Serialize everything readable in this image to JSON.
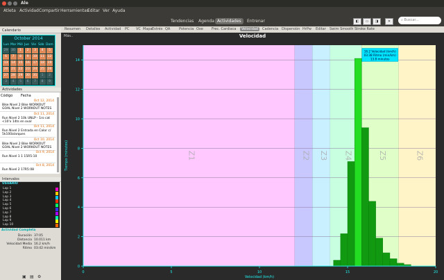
{
  "window": {
    "title": "Ale"
  },
  "menu": [
    "Atleta",
    "Actividad",
    "Compartir",
    "Herramientas",
    "Editar",
    "Ver",
    "Ayuda"
  ],
  "views": [
    {
      "label": "Tendencias",
      "active": false
    },
    {
      "label": "Agenda",
      "active": false
    },
    {
      "label": "Actividades",
      "active": true
    },
    {
      "label": "Entrenar",
      "active": false
    }
  ],
  "search": {
    "placeholder": "Buscar..."
  },
  "calendar": {
    "title": "Calendario",
    "month": "October 2014",
    "dows": [
      "Lun",
      "Mar",
      "Mié",
      "Jue",
      "Vie",
      "Sáb",
      "Dom"
    ],
    "weeks": [
      [
        "29",
        "30",
        "1",
        "2",
        "3",
        "4",
        "5"
      ],
      [
        "6",
        "7",
        "8",
        "9",
        "10",
        "11",
        "12"
      ],
      [
        "13",
        "14",
        "15",
        "16",
        "17",
        "18",
        "19"
      ],
      [
        "20",
        "21",
        "22",
        "23",
        "24",
        "25",
        "26"
      ],
      [
        "27",
        "28",
        "29",
        "30",
        "31",
        "1",
        "2"
      ],
      [
        "3",
        "4",
        "5",
        "6",
        "7",
        "8",
        "9"
      ]
    ]
  },
  "activities": {
    "title": "Actividades",
    "col_code": "Código",
    "col_date": "Fecha",
    "items": [
      {
        "date": "Oct 12, 2014",
        "name": "Bike Nivel 2 Bike  WORKOUT GOAL Nivel 2 WORKOUT NOTES"
      },
      {
        "date": "Oct 11, 2014",
        "name": "Run Nivel 2 10k UNLP - 1ro cat <10'x 14ts en oval"
      },
      {
        "date": "Oct 11, 2014",
        "name": "Run Nivel 2 Entrada en Calor c/ 5k100alarques"
      },
      {
        "date": "Oct 10, 2014",
        "name": "Bike Nivel 2 Bike  WORKOUT GOAL Nivel 2 WORKOUT NOTES"
      },
      {
        "date": "Oct 9, 2014",
        "name": "Run Nivel 1 1 15R5:10"
      },
      {
        "date": "Oct 8, 2014",
        "name": "Run Nivel 2 17R5:08"
      }
    ]
  },
  "intervals": {
    "title": "Intervalos",
    "group": "USUARIO",
    "items": [
      {
        "label": "Lap 1",
        "color": "#ff00cc"
      },
      {
        "label": "Lap 2",
        "color": "#ffcc00"
      },
      {
        "label": "Lap 3",
        "color": "#00ccff"
      },
      {
        "label": "Lap 4",
        "color": "#ff3300"
      },
      {
        "label": "Lap 5",
        "color": "#00ff66"
      },
      {
        "label": "Lap 6",
        "color": "#3333ff"
      },
      {
        "label": "Lap 7",
        "color": "#aa00ff"
      },
      {
        "label": "Lap 8",
        "color": "#00ffaa"
      },
      {
        "label": "Lap 9",
        "color": "#ffff00"
      },
      {
        "label": "Lap 10",
        "color": "#ff6600"
      }
    ]
  },
  "summary": {
    "title": "Actividad Completa",
    "rows": [
      {
        "k": "Duración",
        "v": "37:05"
      },
      {
        "k": "Distancia",
        "v": "10.011 km"
      },
      {
        "k": "Velocidad Media",
        "v": "16.2  km/h"
      },
      {
        "k": "Ritmo",
        "v": "03:42 min/km"
      }
    ]
  },
  "tabs": [
    "Resumen",
    "Detalles",
    "Actividad",
    "PC",
    "VC",
    "Mapa",
    "Estrés",
    "QA",
    "Potencia",
    "Oxe",
    "Frec. Cardiaca",
    "Velocidad",
    "Cadencia",
    "Dispersión",
    "HrPw",
    "Editar",
    "Swim Smooth Stroke Rate"
  ],
  "active_tab": "Velocidad",
  "chart_header": {
    "more": "Más..",
    "title": "Velocidad"
  },
  "chart_data": {
    "type": "bar",
    "title": "Velocidad",
    "xlabel": "Velocidad (km/h)",
    "ylabel": "Tiempo (minutos)",
    "xlim": [
      0,
      20
    ],
    "ylim": [
      0,
      15
    ],
    "xticks": [
      0,
      5,
      10,
      15,
      20
    ],
    "yticks": [
      0,
      2,
      4,
      6,
      8,
      10,
      12,
      14
    ],
    "zones": [
      {
        "name": "Z1",
        "from": 0,
        "to": 12.0,
        "color": "#ffc8ff"
      },
      {
        "name": "Z2",
        "from": 12.0,
        "to": 13.0,
        "color": "#c8c8ff"
      },
      {
        "name": "Z3",
        "from": 13.0,
        "to": 14.0,
        "color": "#c8f0ff"
      },
      {
        "name": "Z4",
        "from": 14.0,
        "to": 15.8,
        "color": "#c8ffe0"
      },
      {
        "name": "Z5",
        "from": 15.8,
        "to": 17.9,
        "color": "#e0ffc8"
      },
      {
        "name": "Z6",
        "from": 17.9,
        "to": 20.0,
        "color": "#fff4c8"
      }
    ],
    "bars": [
      {
        "x": 14.4,
        "y": 0.4
      },
      {
        "x": 14.8,
        "y": 2.2
      },
      {
        "x": 15.2,
        "y": 7.1
      },
      {
        "x": 15.6,
        "y": 14.1
      },
      {
        "x": 16.0,
        "y": 9.4
      },
      {
        "x": 16.4,
        "y": 4.4
      },
      {
        "x": 16.8,
        "y": 1.9
      },
      {
        "x": 17.2,
        "y": 0.9
      },
      {
        "x": 17.6,
        "y": 0.5
      },
      {
        "x": 18.0,
        "y": 0.2
      },
      {
        "x": 18.4,
        "y": 0.1
      }
    ],
    "annotation": [
      "16.2 Velocidad (km/h)",
      "03:38 Ritmo (min/km)",
      "13.8 minutos"
    ]
  }
}
